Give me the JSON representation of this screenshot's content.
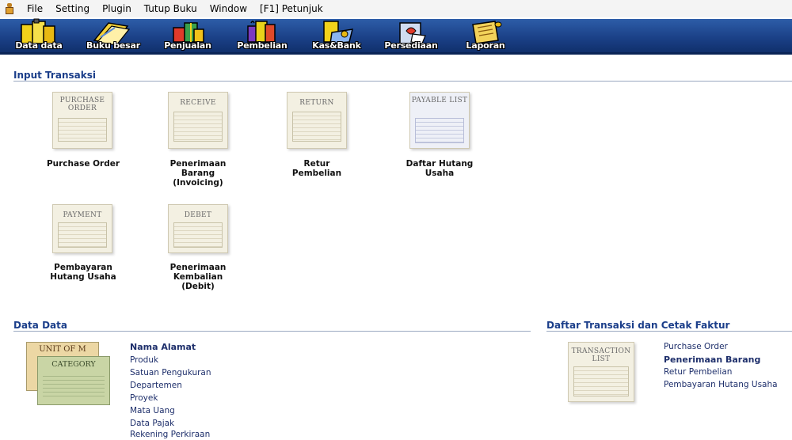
{
  "menu": [
    "File",
    "Setting",
    "Plugin",
    "Tutup Buku",
    "Window",
    "[F1] Petunjuk"
  ],
  "toolbar": [
    "Data data",
    "Buku besar",
    "Penjualan",
    "Pembelian",
    "Kas&Bank",
    "Persediaan",
    "Laporan"
  ],
  "sections": {
    "input": "Input Transaksi",
    "data": "Data Data",
    "daftar": "Daftar Transaksi dan Cetak Faktur"
  },
  "input_items": [
    {
      "doc_title": "PURCHASE ORDER",
      "label": "Purchase Order"
    },
    {
      "doc_title": "RECEIVE",
      "label_lines": [
        "Penerimaan",
        "Barang",
        "(Invoicing)"
      ]
    },
    {
      "doc_title": "RETURN",
      "label_lines": [
        "Retur",
        "Pembelian"
      ]
    },
    {
      "doc_title": "PAYABLE LIST",
      "label_lines": [
        "Daftar Hutang",
        "Usaha"
      ]
    },
    {
      "doc_title": "PAYMENT",
      "label_lines": [
        "Pembayaran",
        "Hutang Usaha"
      ]
    },
    {
      "doc_title": "DEBET",
      "label_lines": [
        "Penerimaan",
        "Kembalian",
        "(Debit)"
      ]
    }
  ],
  "data_cards": {
    "unit": "UNIT OF M",
    "category": "CATEGORY"
  },
  "data_links": [
    "Nama Alamat",
    "Produk",
    "Satuan Pengukuran",
    "Departemen",
    "Proyek",
    "Mata Uang",
    "Data Pajak",
    "Rekening Perkiraan"
  ],
  "transaction_list_title": "TRANSACTION LIST",
  "daftar_links": [
    "Purchase Order",
    "Penerimaan Barang",
    "Retur Pembelian",
    "Pembayaran Hutang Usaha"
  ]
}
